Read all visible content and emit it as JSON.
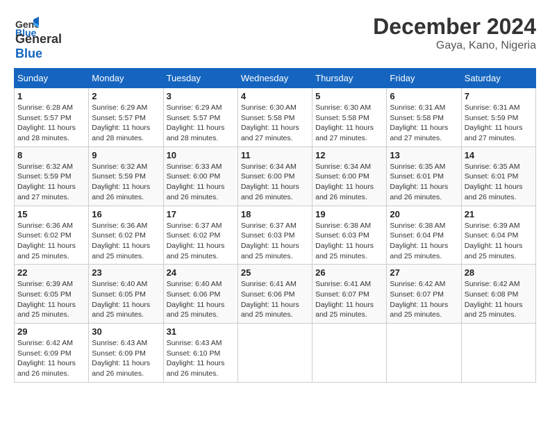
{
  "header": {
    "logo_line1": "General",
    "logo_line2": "Blue",
    "month": "December 2024",
    "location": "Gaya, Kano, Nigeria"
  },
  "weekdays": [
    "Sunday",
    "Monday",
    "Tuesday",
    "Wednesday",
    "Thursday",
    "Friday",
    "Saturday"
  ],
  "weeks": [
    [
      {
        "day": "1",
        "info": "Sunrise: 6:28 AM\nSunset: 5:57 PM\nDaylight: 11 hours and 28 minutes."
      },
      {
        "day": "2",
        "info": "Sunrise: 6:29 AM\nSunset: 5:57 PM\nDaylight: 11 hours and 28 minutes."
      },
      {
        "day": "3",
        "info": "Sunrise: 6:29 AM\nSunset: 5:57 PM\nDaylight: 11 hours and 28 minutes."
      },
      {
        "day": "4",
        "info": "Sunrise: 6:30 AM\nSunset: 5:58 PM\nDaylight: 11 hours and 27 minutes."
      },
      {
        "day": "5",
        "info": "Sunrise: 6:30 AM\nSunset: 5:58 PM\nDaylight: 11 hours and 27 minutes."
      },
      {
        "day": "6",
        "info": "Sunrise: 6:31 AM\nSunset: 5:58 PM\nDaylight: 11 hours and 27 minutes."
      },
      {
        "day": "7",
        "info": "Sunrise: 6:31 AM\nSunset: 5:59 PM\nDaylight: 11 hours and 27 minutes."
      }
    ],
    [
      {
        "day": "8",
        "info": "Sunrise: 6:32 AM\nSunset: 5:59 PM\nDaylight: 11 hours and 27 minutes."
      },
      {
        "day": "9",
        "info": "Sunrise: 6:32 AM\nSunset: 5:59 PM\nDaylight: 11 hours and 26 minutes."
      },
      {
        "day": "10",
        "info": "Sunrise: 6:33 AM\nSunset: 6:00 PM\nDaylight: 11 hours and 26 minutes."
      },
      {
        "day": "11",
        "info": "Sunrise: 6:34 AM\nSunset: 6:00 PM\nDaylight: 11 hours and 26 minutes."
      },
      {
        "day": "12",
        "info": "Sunrise: 6:34 AM\nSunset: 6:00 PM\nDaylight: 11 hours and 26 minutes."
      },
      {
        "day": "13",
        "info": "Sunrise: 6:35 AM\nSunset: 6:01 PM\nDaylight: 11 hours and 26 minutes."
      },
      {
        "day": "14",
        "info": "Sunrise: 6:35 AM\nSunset: 6:01 PM\nDaylight: 11 hours and 26 minutes."
      }
    ],
    [
      {
        "day": "15",
        "info": "Sunrise: 6:36 AM\nSunset: 6:02 PM\nDaylight: 11 hours and 25 minutes."
      },
      {
        "day": "16",
        "info": "Sunrise: 6:36 AM\nSunset: 6:02 PM\nDaylight: 11 hours and 25 minutes."
      },
      {
        "day": "17",
        "info": "Sunrise: 6:37 AM\nSunset: 6:02 PM\nDaylight: 11 hours and 25 minutes."
      },
      {
        "day": "18",
        "info": "Sunrise: 6:37 AM\nSunset: 6:03 PM\nDaylight: 11 hours and 25 minutes."
      },
      {
        "day": "19",
        "info": "Sunrise: 6:38 AM\nSunset: 6:03 PM\nDaylight: 11 hours and 25 minutes."
      },
      {
        "day": "20",
        "info": "Sunrise: 6:38 AM\nSunset: 6:04 PM\nDaylight: 11 hours and 25 minutes."
      },
      {
        "day": "21",
        "info": "Sunrise: 6:39 AM\nSunset: 6:04 PM\nDaylight: 11 hours and 25 minutes."
      }
    ],
    [
      {
        "day": "22",
        "info": "Sunrise: 6:39 AM\nSunset: 6:05 PM\nDaylight: 11 hours and 25 minutes."
      },
      {
        "day": "23",
        "info": "Sunrise: 6:40 AM\nSunset: 6:05 PM\nDaylight: 11 hours and 25 minutes."
      },
      {
        "day": "24",
        "info": "Sunrise: 6:40 AM\nSunset: 6:06 PM\nDaylight: 11 hours and 25 minutes."
      },
      {
        "day": "25",
        "info": "Sunrise: 6:41 AM\nSunset: 6:06 PM\nDaylight: 11 hours and 25 minutes."
      },
      {
        "day": "26",
        "info": "Sunrise: 6:41 AM\nSunset: 6:07 PM\nDaylight: 11 hours and 25 minutes."
      },
      {
        "day": "27",
        "info": "Sunrise: 6:42 AM\nSunset: 6:07 PM\nDaylight: 11 hours and 25 minutes."
      },
      {
        "day": "28",
        "info": "Sunrise: 6:42 AM\nSunset: 6:08 PM\nDaylight: 11 hours and 25 minutes."
      }
    ],
    [
      {
        "day": "29",
        "info": "Sunrise: 6:42 AM\nSunset: 6:09 PM\nDaylight: 11 hours and 26 minutes."
      },
      {
        "day": "30",
        "info": "Sunrise: 6:43 AM\nSunset: 6:09 PM\nDaylight: 11 hours and 26 minutes."
      },
      {
        "day": "31",
        "info": "Sunrise: 6:43 AM\nSunset: 6:10 PM\nDaylight: 11 hours and 26 minutes."
      },
      {
        "day": "",
        "info": ""
      },
      {
        "day": "",
        "info": ""
      },
      {
        "day": "",
        "info": ""
      },
      {
        "day": "",
        "info": ""
      }
    ]
  ]
}
